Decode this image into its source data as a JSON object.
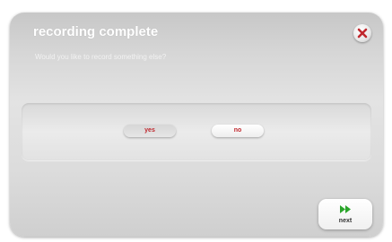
{
  "dialog": {
    "title": "recording complete",
    "subtitle": "Would you like to record something else?",
    "close_icon": "close-x-icon",
    "yes_label": "yes",
    "no_label": "no",
    "next_label": "next",
    "next_icon": "fast-forward-icon"
  },
  "colors": {
    "accent_red": "#c0282e",
    "next_green": "#2aa52a",
    "panel_gray": "#dcdcdc"
  }
}
